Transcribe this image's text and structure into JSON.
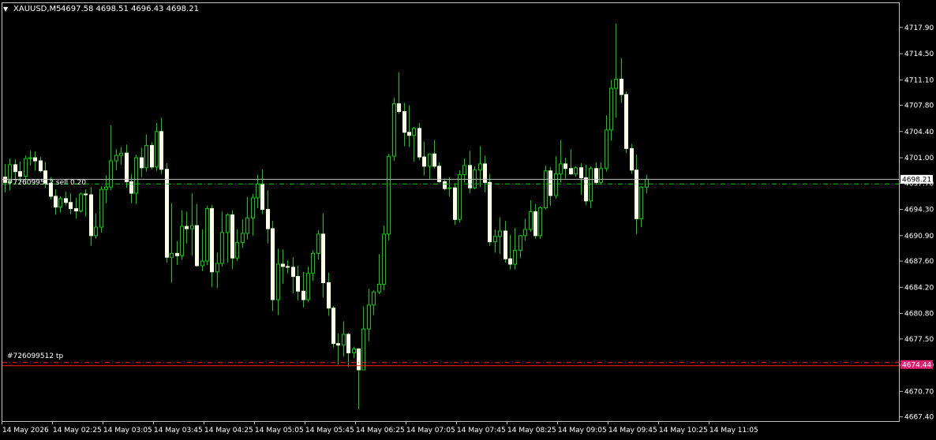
{
  "header": {
    "arrow": "▼",
    "symbol": "XAUUSD,M5",
    "ohlc": "4697.58 4698.51 4696.43 4698.21"
  },
  "colors": {
    "background": "#000000",
    "candle_body": "#ffffe8",
    "candle_wick": "#00d000",
    "axis": "#c0c0c0",
    "text": "#ffffff",
    "bid_line": "#c0c0c0",
    "order_line": "#00c800",
    "tp_line": "#ff2020",
    "tp_label_bg": "#e0206e"
  },
  "chart_data": {
    "type": "candlestick",
    "symbol": "XAUUSD",
    "timeframe": "M5",
    "grid": false,
    "ylim": [
      4666.85,
      4721.05
    ],
    "y_ticks": [
      "4717.90",
      "4714.50",
      "4711.10",
      "4707.80",
      "4704.40",
      "4701.00",
      "4697.70",
      "4694.30",
      "4690.90",
      "4687.60",
      "4684.20",
      "4680.80",
      "4677.50",
      "4674.10",
      "4670.70",
      "4667.40"
    ],
    "y_tick_values": [
      4717.9,
      4714.5,
      4711.1,
      4707.8,
      4704.4,
      4701.0,
      4697.7,
      4694.3,
      4690.9,
      4687.6,
      4684.2,
      4680.8,
      4677.5,
      4674.1,
      4670.7,
      4667.4
    ],
    "x_labels": [
      "14 May 2026",
      "14 May 02:25",
      "14 May 03:05",
      "14 May 03:45",
      "14 May 04:25",
      "14 May 05:05",
      "14 May 05:45",
      "14 May 06:25",
      "14 May 07:05",
      "14 May 07:45",
      "14 May 08:25",
      "14 May 09:05",
      "14 May 09:45",
      "14 May 10:25",
      "14 May 11:05"
    ],
    "current_price": "4698.21",
    "current_price_value": 4698.21,
    "order_price_value": 4697.6,
    "tp_price": "4674.44",
    "tp_price_value": 4674.44,
    "order_label": "#726099512 sell 0.20",
    "tp_label": "#726099512 tp",
    "candles": [
      [
        4698.5,
        4700.2,
        4696.5,
        4697.8
      ],
      [
        4697.8,
        4700.9,
        4696.8,
        4700.1
      ],
      [
        4700.1,
        4700.8,
        4698.1,
        4699.2
      ],
      [
        4699.2,
        4700.5,
        4697.9,
        4698.6
      ],
      [
        4698.6,
        4701.3,
        4697.6,
        4700.9
      ],
      [
        4700.9,
        4701.9,
        4700.0,
        4701.0
      ],
      [
        4701.0,
        4701.8,
        4699.3,
        4700.6
      ],
      [
        4700.6,
        4701.1,
        4699.1,
        4699.3
      ],
      [
        4699.3,
        4700.5,
        4697.1,
        4697.7
      ],
      [
        4697.7,
        4698.5,
        4695.6,
        4696.0
      ],
      [
        4696.0,
        4696.9,
        4693.6,
        4694.6
      ],
      [
        4694.6,
        4696.0,
        4693.9,
        4695.7
      ],
      [
        4695.7,
        4696.6,
        4694.8,
        4695.2
      ],
      [
        4695.2,
        4696.4,
        4693.7,
        4694.4
      ],
      [
        4694.4,
        4695.8,
        4693.1,
        4694.1
      ],
      [
        4694.1,
        4696.5,
        4693.9,
        4696.3
      ],
      [
        4696.3,
        4696.9,
        4693.4,
        4696.2
      ],
      [
        4696.2,
        4697.2,
        4689.6,
        4690.9
      ],
      [
        4690.9,
        4693.8,
        4690.5,
        4692.0
      ],
      [
        4692.0,
        4697.3,
        4691.3,
        4696.9
      ],
      [
        4696.9,
        4698.7,
        4695.1,
        4697.2
      ],
      [
        4697.2,
        4705.2,
        4696.8,
        4700.6
      ],
      [
        4700.6,
        4702.1,
        4699.4,
        4701.3
      ],
      [
        4701.3,
        4702.4,
        4700.1,
        4701.6
      ],
      [
        4701.6,
        4702.7,
        4697.1,
        4697.9
      ],
      [
        4697.9,
        4698.9,
        4695.1,
        4696.4
      ],
      [
        4696.4,
        4701.4,
        4695.0,
        4701.0
      ],
      [
        4701.0,
        4702.3,
        4698.5,
        4699.7
      ],
      [
        4699.7,
        4704.0,
        4699.2,
        4702.6
      ],
      [
        4702.6,
        4703.0,
        4699.5,
        4699.8
      ],
      [
        4699.8,
        4705.5,
        4699.3,
        4704.4
      ],
      [
        4704.4,
        4706.2,
        4698.9,
        4699.5
      ],
      [
        4699.5,
        4700.3,
        4687.4,
        4688.1
      ],
      [
        4688.1,
        4695.1,
        4684.8,
        4688.6
      ],
      [
        4688.6,
        4690.2,
        4687.1,
        4688.3
      ],
      [
        4688.3,
        4694.2,
        4687.8,
        4692.1
      ],
      [
        4692.1,
        4694.0,
        4689.9,
        4691.8
      ],
      [
        4691.8,
        4696.4,
        4688.3,
        4692.2
      ],
      [
        4692.2,
        4695.0,
        4686.9,
        4687.0
      ],
      [
        4687.0,
        4691.7,
        4686.3,
        4687.6
      ],
      [
        4687.6,
        4694.8,
        4687.1,
        4694.4
      ],
      [
        4694.4,
        4694.9,
        4684.2,
        4686.2
      ],
      [
        4686.2,
        4688.7,
        4684.1,
        4687.3
      ],
      [
        4687.3,
        4694.0,
        4686.9,
        4691.3
      ],
      [
        4691.3,
        4693.8,
        4687.4,
        4693.6
      ],
      [
        4693.6,
        4694.2,
        4686.6,
        4688.0
      ],
      [
        4688.0,
        4691.7,
        4687.6,
        4690.0
      ],
      [
        4690.0,
        4693.0,
        4689.3,
        4691.2
      ],
      [
        4691.2,
        4695.9,
        4690.4,
        4693.2
      ],
      [
        4693.2,
        4696.3,
        4690.9,
        4695.8
      ],
      [
        4695.8,
        4698.8,
        4694.5,
        4697.6
      ],
      [
        4697.6,
        4699.5,
        4693.7,
        4694.3
      ],
      [
        4694.3,
        4696.8,
        4689.9,
        4691.8
      ],
      [
        4691.8,
        4692.8,
        4681.1,
        4682.6
      ],
      [
        4682.6,
        4689.2,
        4680.6,
        4687.2
      ],
      [
        4687.2,
        4689.1,
        4684.7,
        4686.9
      ],
      [
        4686.9,
        4687.7,
        4686.0,
        4686.8
      ],
      [
        4686.8,
        4688.1,
        4683.4,
        4685.6
      ],
      [
        4685.6,
        4687.0,
        4682.5,
        4683.7
      ],
      [
        4683.7,
        4686.2,
        4681.6,
        4682.6
      ],
      [
        4682.6,
        4686.9,
        4682.3,
        4686.0
      ],
      [
        4686.0,
        4689.0,
        4685.0,
        4688.6
      ],
      [
        4688.6,
        4691.6,
        4687.8,
        4691.1
      ],
      [
        4691.1,
        4693.8,
        4682.9,
        4684.8
      ],
      [
        4684.8,
        4686.1,
        4680.5,
        4681.5
      ],
      [
        4681.5,
        4681.8,
        4676.4,
        4676.9
      ],
      [
        4676.9,
        4678.2,
        4674.2,
        4676.7
      ],
      [
        4676.7,
        4679.8,
        4675.2,
        4678.1
      ],
      [
        4678.1,
        4678.3,
        4673.9,
        4675.7
      ],
      [
        4675.7,
        4676.5,
        4675.0,
        4676.2
      ],
      [
        4676.2,
        4676.3,
        4668.4,
        4673.5
      ],
      [
        4673.5,
        4681.7,
        4673.5,
        4678.8
      ],
      [
        4678.8,
        4684.0,
        4677.2,
        4681.9
      ],
      [
        4681.9,
        4683.8,
        4680.6,
        4683.6
      ],
      [
        4683.6,
        4688.5,
        4683.3,
        4684.6
      ],
      [
        4684.6,
        4692.2,
        4683.8,
        4691.1
      ],
      [
        4691.1,
        4701.5,
        4690.3,
        4701.2
      ],
      [
        4701.2,
        4708.8,
        4700.6,
        4708.0
      ],
      [
        4708.0,
        4712.1,
        4706.7,
        4707.0
      ],
      [
        4707.0,
        4708.1,
        4702.5,
        4704.3
      ],
      [
        4704.3,
        4707.8,
        4702.4,
        4703.9
      ],
      [
        4703.9,
        4705.0,
        4700.5,
        4704.8
      ],
      [
        4704.8,
        4705.5,
        4700.7,
        4701.1
      ],
      [
        4701.1,
        4703.1,
        4698.7,
        4699.9
      ],
      [
        4699.9,
        4701.0,
        4698.2,
        4701.5
      ],
      [
        4701.5,
        4703.3,
        4699.6,
        4699.9
      ],
      [
        4699.9,
        4700.4,
        4697.7,
        4697.9
      ],
      [
        4697.9,
        4698.3,
        4696.8,
        4697.0
      ],
      [
        4697.0,
        4698.5,
        4696.0,
        4697.1
      ],
      [
        4697.1,
        4697.7,
        4692.3,
        4693.0
      ],
      [
        4693.0,
        4699.4,
        4692.6,
        4698.8
      ],
      [
        4698.8,
        4700.9,
        4697.8,
        4700.0
      ],
      [
        4700.0,
        4701.9,
        4696.4,
        4697.1
      ],
      [
        4697.1,
        4699.9,
        4696.9,
        4699.4
      ],
      [
        4699.4,
        4702.5,
        4697.2,
        4700.2
      ],
      [
        4700.2,
        4701.3,
        4696.5,
        4697.8
      ],
      [
        4697.8,
        4698.9,
        4689.6,
        4690.1
      ],
      [
        4690.1,
        4691.7,
        4688.7,
        4690.8
      ],
      [
        4690.8,
        4693.3,
        4688.5,
        4691.5
      ],
      [
        4691.5,
        4692.8,
        4687.4,
        4687.9
      ],
      [
        4687.9,
        4691.0,
        4686.5,
        4687.2
      ],
      [
        4687.2,
        4691.9,
        4686.5,
        4689.0
      ],
      [
        4689.0,
        4691.0,
        4688.0,
        4690.9
      ],
      [
        4690.9,
        4693.1,
        4690.3,
        4691.7
      ],
      [
        4691.7,
        4695.5,
        4691.4,
        4694.0
      ],
      [
        4694.0,
        4695.0,
        4690.5,
        4690.9
      ],
      [
        4690.9,
        4694.7,
        4690.5,
        4694.5
      ],
      [
        4694.5,
        4700.0,
        4694.3,
        4699.3
      ],
      [
        4699.3,
        4699.8,
        4694.8,
        4696.1
      ],
      [
        4696.1,
        4701.2,
        4695.7,
        4698.9
      ],
      [
        4698.9,
        4703.3,
        4697.8,
        4700.2
      ],
      [
        4700.2,
        4701.0,
        4698.3,
        4699.6
      ],
      [
        4699.6,
        4702.1,
        4698.8,
        4698.9
      ],
      [
        4698.9,
        4699.9,
        4698.5,
        4699.7
      ],
      [
        4699.7,
        4700.3,
        4696.2,
        4698.4
      ],
      [
        4698.4,
        4700.1,
        4694.9,
        4695.4
      ],
      [
        4695.4,
        4699.9,
        4694.5,
        4699.6
      ],
      [
        4699.6,
        4700.4,
        4697.5,
        4697.8
      ],
      [
        4697.8,
        4700.4,
        4697.5,
        4699.6
      ],
      [
        4699.6,
        4706.5,
        4699.2,
        4704.6
      ],
      [
        4704.6,
        4711.1,
        4703.2,
        4710.0
      ],
      [
        4710.0,
        4718.4,
        4706.2,
        4711.2
      ],
      [
        4711.2,
        4713.9,
        4708.1,
        4709.2
      ],
      [
        4709.2,
        4709.6,
        4701.6,
        4702.2
      ],
      [
        4702.2,
        4702.8,
        4698.9,
        4699.4
      ],
      [
        4699.4,
        4701.4,
        4691.1,
        4693.1
      ],
      [
        4693.1,
        4697.3,
        4692.0,
        4697.2
      ],
      [
        4697.2,
        4698.8,
        4696.4,
        4698.2
      ]
    ]
  }
}
